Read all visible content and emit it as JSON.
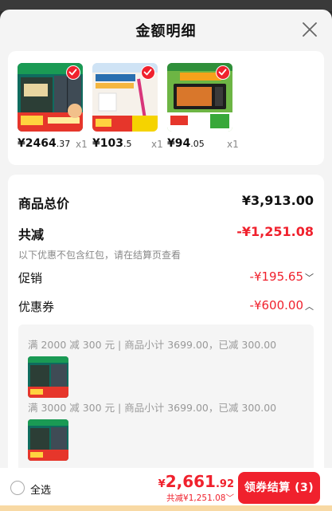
{
  "dialog": {
    "title": "金额明细"
  },
  "products": [
    {
      "price_int": "¥2464",
      "price_dec": ".37",
      "qty": "x1"
    },
    {
      "price_int": "¥103",
      "price_dec": ".5",
      "qty": "x1"
    },
    {
      "price_int": "¥94",
      "price_dec": ".05",
      "qty": "x1"
    }
  ],
  "summary": {
    "total_label": "商品总价",
    "total_value": "¥3,913.00",
    "reduce_label": "共减",
    "reduce_value": "-¥1,251.08",
    "reduce_note": "以下优惠不包含红包，请在结算页查看",
    "promo_label": "促销",
    "promo_value": "-¥195.65",
    "coupon_label": "优惠券",
    "coupon_value": "-¥600.00"
  },
  "coupons": [
    {
      "text": "满 2000 减 300 元 | 商品小计 3699.00，已减 300.00"
    },
    {
      "text": "满 3000 减 300 元 | 商品小计 3699.00，已减 300.00"
    }
  ],
  "footer": {
    "select_all": "全选",
    "currency": "¥",
    "total_int": "2,661",
    "total_dec": ".92",
    "discount_text": "共减¥1,251.08",
    "checkout_label": "领券结算 (3)"
  },
  "colors": {
    "accent": "#f0212d"
  }
}
